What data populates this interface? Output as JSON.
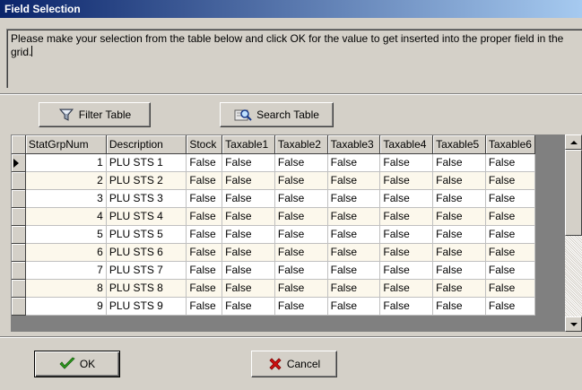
{
  "window": {
    "title": "Field Selection"
  },
  "message": {
    "text": "Please make your selection from the table below and click OK for the value to get inserted into the proper field in the grid."
  },
  "toolbar": {
    "filter_label": "Filter Table",
    "search_label": "Search Table"
  },
  "grid": {
    "columns": [
      "StatGrpNum",
      "Description",
      "Stock",
      "Taxable1",
      "Taxable2",
      "Taxable3",
      "Taxable4",
      "Taxable5",
      "Taxable6"
    ],
    "rows": [
      [
        "1",
        "PLU STS 1",
        "False",
        "False",
        "False",
        "False",
        "False",
        "False",
        "False"
      ],
      [
        "2",
        "PLU STS 2",
        "False",
        "False",
        "False",
        "False",
        "False",
        "False",
        "False"
      ],
      [
        "3",
        "PLU STS 3",
        "False",
        "False",
        "False",
        "False",
        "False",
        "False",
        "False"
      ],
      [
        "4",
        "PLU STS 4",
        "False",
        "False",
        "False",
        "False",
        "False",
        "False",
        "False"
      ],
      [
        "5",
        "PLU STS 5",
        "False",
        "False",
        "False",
        "False",
        "False",
        "False",
        "False"
      ],
      [
        "6",
        "PLU STS 6",
        "False",
        "False",
        "False",
        "False",
        "False",
        "False",
        "False"
      ],
      [
        "7",
        "PLU STS 7",
        "False",
        "False",
        "False",
        "False",
        "False",
        "False",
        "False"
      ],
      [
        "8",
        "PLU STS 8",
        "False",
        "False",
        "False",
        "False",
        "False",
        "False",
        "False"
      ],
      [
        "9",
        "PLU STS 9",
        "False",
        "False",
        "False",
        "False",
        "False",
        "False",
        "False"
      ]
    ]
  },
  "footer": {
    "ok_label": "OK",
    "cancel_label": "Cancel"
  },
  "icons": {
    "filter": "filter-icon",
    "search": "search-icon",
    "ok": "checkmark-icon",
    "cancel": "x-icon"
  },
  "colors": {
    "title_start": "#0a246a",
    "title_end": "#a6caf0",
    "ok_green": "#2e9e1e",
    "cancel_red": "#d01010",
    "row_alt": "#fcf8ec"
  }
}
